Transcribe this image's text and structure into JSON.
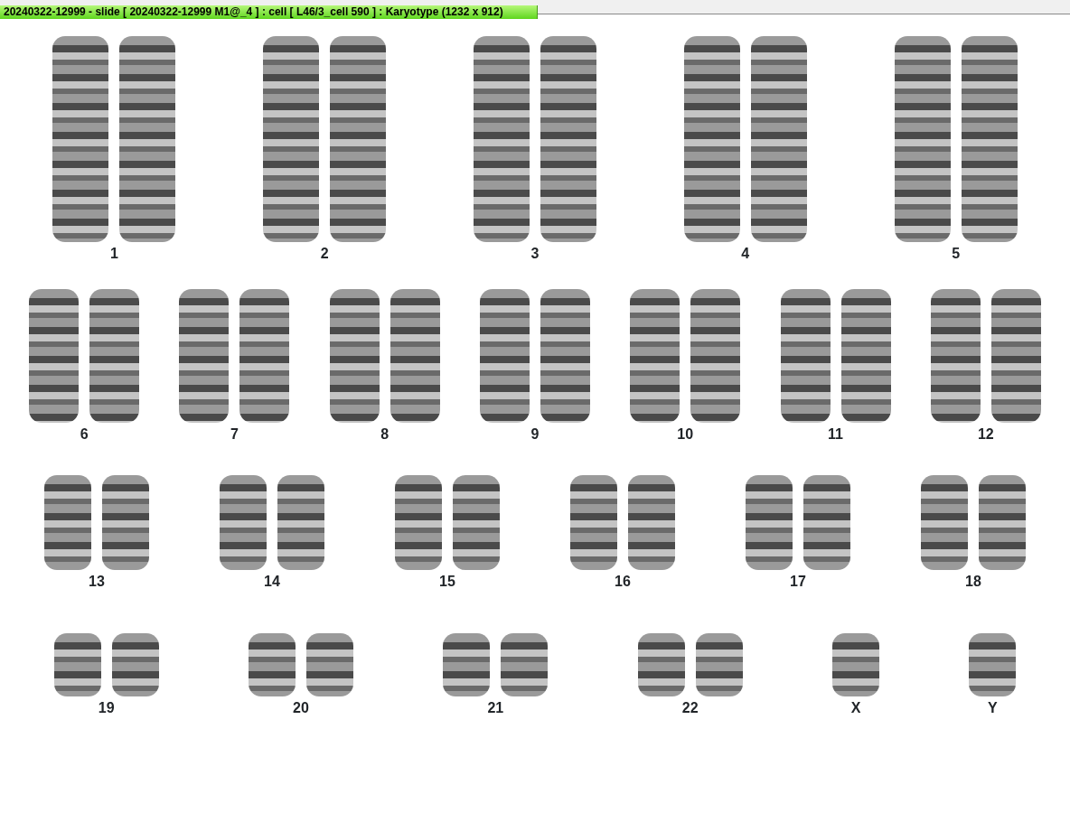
{
  "window": {
    "title": "20240322-12999 - slide [ 20240322-12999 M1@_4 ] : cell [ L46/3_cell 590 ] : Karyotype  (1232 x 912)"
  },
  "karyotype": {
    "rows": [
      {
        "groups": [
          {
            "label": "1",
            "kind": "pair"
          },
          {
            "label": "2",
            "kind": "pair"
          },
          {
            "label": "3",
            "kind": "pair"
          },
          {
            "label": "4",
            "kind": "pair"
          },
          {
            "label": "5",
            "kind": "pair"
          }
        ]
      },
      {
        "groups": [
          {
            "label": "6",
            "kind": "pair"
          },
          {
            "label": "7",
            "kind": "pair"
          },
          {
            "label": "8",
            "kind": "pair"
          },
          {
            "label": "9",
            "kind": "pair"
          },
          {
            "label": "10",
            "kind": "pair"
          },
          {
            "label": "11",
            "kind": "pair"
          },
          {
            "label": "12",
            "kind": "pair"
          }
        ]
      },
      {
        "groups": [
          {
            "label": "13",
            "kind": "pair"
          },
          {
            "label": "14",
            "kind": "pair"
          },
          {
            "label": "15",
            "kind": "pair"
          },
          {
            "label": "16",
            "kind": "pair"
          },
          {
            "label": "17",
            "kind": "pair"
          },
          {
            "label": "18",
            "kind": "pair"
          }
        ]
      },
      {
        "groups": [
          {
            "label": "19",
            "kind": "pair"
          },
          {
            "label": "20",
            "kind": "pair"
          },
          {
            "label": "21",
            "kind": "pair"
          },
          {
            "label": "22",
            "kind": "pair"
          },
          {
            "label": "X",
            "kind": "single"
          },
          {
            "label": "Y",
            "kind": "single"
          }
        ]
      }
    ]
  }
}
